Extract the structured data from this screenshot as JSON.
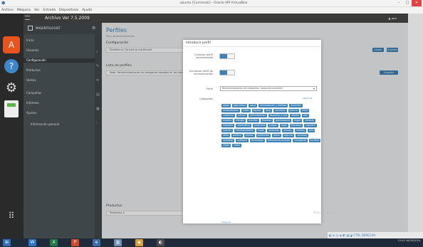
{
  "window": {
    "title": "ubuntu [Corriendo] - Oracle VM VirtualBox",
    "menu": [
      "Archivo",
      "Máquina",
      "Ver",
      "Entrada",
      "Dispositivos",
      "Ayuda"
    ]
  },
  "guest_topbar": {
    "title": "Archivo  Ver  7.5.2009",
    "right": "▲  ◂◂ ▸"
  },
  "sidebar": {
    "site_name": "MAGENTOLOGIST",
    "items": [
      "Inicio",
      "Usuarios",
      "Configuración",
      "Productos",
      "Ventas",
      "Campañas",
      "Informes",
      "Ajustes"
    ],
    "active_item": "Configuración",
    "sub_items": [
      "Información general"
    ]
  },
  "content": {
    "title": "Perfiles",
    "subtitle": "Para recomendaciones",
    "section1": "Configuración",
    "row1_text": "Enabled on Convert-to-Cartfunnel",
    "section2": "Lista de perfiles",
    "row2_text": "Nota: Recomendaciones de categorías basadas en los datos de navegación",
    "btn1": "Añadir",
    "btn2": "Guardar",
    "section3": "Productos",
    "row3_text": "Productos A"
  },
  "modal": {
    "title": "Introducir perfil",
    "field1_label": "Conectar perfil recomendado",
    "field2_label": "Actualizar perfil de recomendación",
    "select_label": "Perfil",
    "select_value": "Recomendaciones de categorías, productos similares",
    "categories_label": "Categorías",
    "select_all": "select all",
    "tags": [
      "aprox",
      "agricultura",
      "agua",
      "alimentación y bebidas",
      "anuncios",
      "audiovisuales",
      "autos",
      "bancos",
      "blog",
      "cerámica",
      "ciencia",
      "clima",
      "comercio",
      "cultura",
      "comunicación",
      "deportes y ocio",
      "diseño",
      "edu",
      "empleo",
      "energía",
      "eventos",
      "finanzas",
      "gastronomía",
      "hogar",
      "idiomas",
      "industria",
      "informática",
      "jardinería",
      "juegos",
      "legal",
      "literatura",
      "logística",
      "marcas",
      "medioambiente",
      "moda",
      "mascotas",
      "música",
      "noticias",
      "ocio",
      "otros",
      "política",
      "prensa",
      "publicidad",
      "salud",
      "seguros",
      "servicios",
      "sociedad",
      "software",
      "tecnología",
      "telecomunicaciones",
      "transporte",
      "turismo",
      "viajes",
      "vídeo"
    ],
    "more_link": "Show all"
  },
  "statusbar": "◧ ⊕ ◫ ◈ ◩ ◨ ◪  CTRL DERECHA",
  "watermark": "Activar Windows",
  "clock": {
    "time": "12:40",
    "date": "16/05/2016"
  },
  "colors": {
    "accent": "#3d82b6",
    "sidebar": "#3f4649",
    "launcher": "#2a2a2a",
    "taskbar": "#1f2b3a"
  }
}
